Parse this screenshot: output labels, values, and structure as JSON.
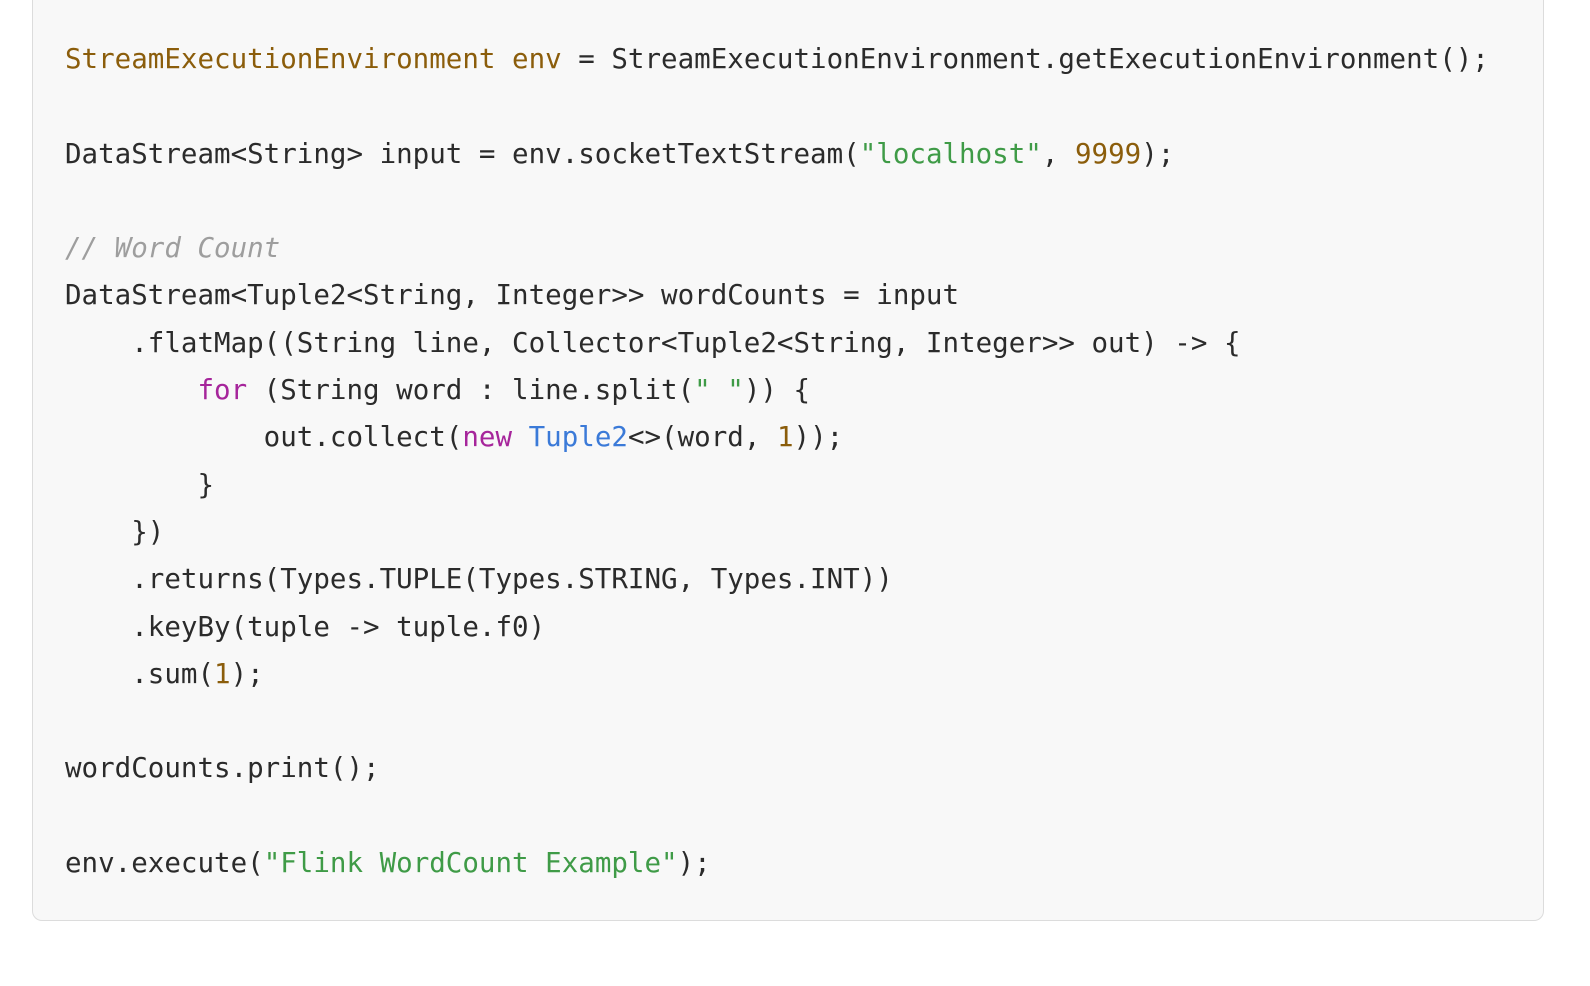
{
  "code": {
    "lines": [
      [
        {
          "t": "type",
          "s": "StreamExecutionEnvironment"
        },
        {
          "t": "plain",
          "s": " "
        },
        {
          "t": "var",
          "s": "env"
        },
        {
          "t": "plain",
          "s": " = StreamExecutionEnvironment.getExecutionEnvironment();"
        }
      ],
      [],
      [
        {
          "t": "plain",
          "s": "DataStream<String> input = env.socketTextStream("
        },
        {
          "t": "str",
          "s": "\"localhost\""
        },
        {
          "t": "plain",
          "s": ", "
        },
        {
          "t": "num",
          "s": "9999"
        },
        {
          "t": "plain",
          "s": ");"
        }
      ],
      [],
      [
        {
          "t": "cmt",
          "s": "// Word Count"
        }
      ],
      [
        {
          "t": "plain",
          "s": "DataStream<Tuple2<String, Integer>> wordCounts = input"
        }
      ],
      [
        {
          "t": "plain",
          "s": "    .flatMap((String line, Collector<Tuple2<String, Integer>> out) -> {"
        }
      ],
      [
        {
          "t": "plain",
          "s": "        "
        },
        {
          "t": "kw",
          "s": "for"
        },
        {
          "t": "plain",
          "s": " (String word : line.split("
        },
        {
          "t": "str",
          "s": "\" \""
        },
        {
          "t": "plain",
          "s": ")) {"
        }
      ],
      [
        {
          "t": "plain",
          "s": "            out.collect("
        },
        {
          "t": "kw",
          "s": "new"
        },
        {
          "t": "plain",
          "s": " "
        },
        {
          "t": "cls",
          "s": "Tuple2"
        },
        {
          "t": "plain",
          "s": "<>(word, "
        },
        {
          "t": "num",
          "s": "1"
        },
        {
          "t": "plain",
          "s": "));"
        }
      ],
      [
        {
          "t": "plain",
          "s": "        }"
        }
      ],
      [
        {
          "t": "plain",
          "s": "    })"
        }
      ],
      [
        {
          "t": "plain",
          "s": "    .returns(Types.TUPLE(Types.STRING, Types.INT))"
        }
      ],
      [
        {
          "t": "plain",
          "s": "    .keyBy(tuple -> tuple.f0)"
        }
      ],
      [
        {
          "t": "plain",
          "s": "    .sum("
        },
        {
          "t": "num",
          "s": "1"
        },
        {
          "t": "plain",
          "s": ");"
        }
      ],
      [],
      [
        {
          "t": "plain",
          "s": "wordCounts.print();"
        }
      ],
      [],
      [
        {
          "t": "plain",
          "s": "env.execute("
        },
        {
          "t": "str",
          "s": "\"Flink WordCount Example\""
        },
        {
          "t": "plain",
          "s": ");"
        }
      ]
    ]
  },
  "colors": {
    "background": "#f8f8f8",
    "text": "#2b2b2b",
    "type": "#8b5d0b",
    "string": "#3f9b47",
    "number": "#8b5d0b",
    "keyword": "#a6259b",
    "class": "#3b7ad8",
    "comment": "#9e9e9e"
  }
}
